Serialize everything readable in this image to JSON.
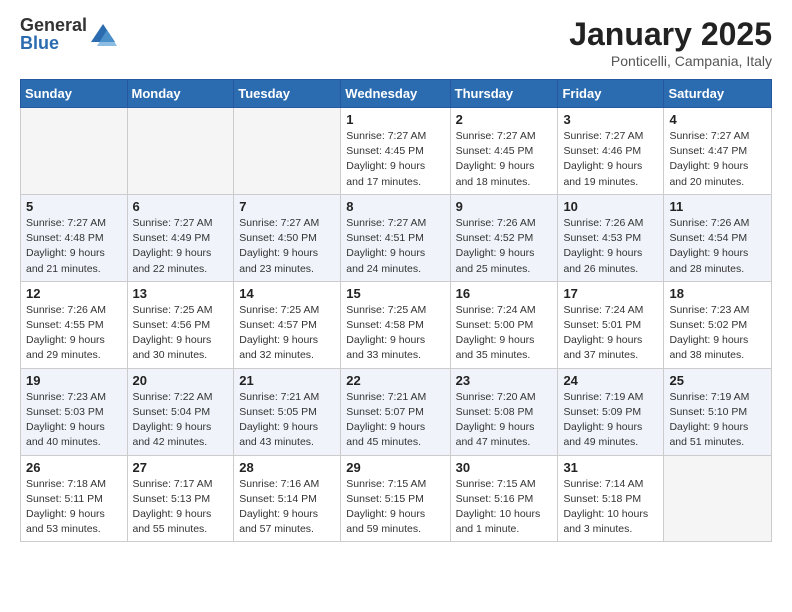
{
  "logo": {
    "general": "General",
    "blue": "Blue"
  },
  "title": {
    "month": "January 2025",
    "location": "Ponticelli, Campania, Italy"
  },
  "weekdays": [
    "Sunday",
    "Monday",
    "Tuesday",
    "Wednesday",
    "Thursday",
    "Friday",
    "Saturday"
  ],
  "weeks": [
    [
      {
        "day": "",
        "info": ""
      },
      {
        "day": "",
        "info": ""
      },
      {
        "day": "",
        "info": ""
      },
      {
        "day": "1",
        "info": "Sunrise: 7:27 AM\nSunset: 4:45 PM\nDaylight: 9 hours\nand 17 minutes."
      },
      {
        "day": "2",
        "info": "Sunrise: 7:27 AM\nSunset: 4:45 PM\nDaylight: 9 hours\nand 18 minutes."
      },
      {
        "day": "3",
        "info": "Sunrise: 7:27 AM\nSunset: 4:46 PM\nDaylight: 9 hours\nand 19 minutes."
      },
      {
        "day": "4",
        "info": "Sunrise: 7:27 AM\nSunset: 4:47 PM\nDaylight: 9 hours\nand 20 minutes."
      }
    ],
    [
      {
        "day": "5",
        "info": "Sunrise: 7:27 AM\nSunset: 4:48 PM\nDaylight: 9 hours\nand 21 minutes."
      },
      {
        "day": "6",
        "info": "Sunrise: 7:27 AM\nSunset: 4:49 PM\nDaylight: 9 hours\nand 22 minutes."
      },
      {
        "day": "7",
        "info": "Sunrise: 7:27 AM\nSunset: 4:50 PM\nDaylight: 9 hours\nand 23 minutes."
      },
      {
        "day": "8",
        "info": "Sunrise: 7:27 AM\nSunset: 4:51 PM\nDaylight: 9 hours\nand 24 minutes."
      },
      {
        "day": "9",
        "info": "Sunrise: 7:26 AM\nSunset: 4:52 PM\nDaylight: 9 hours\nand 25 minutes."
      },
      {
        "day": "10",
        "info": "Sunrise: 7:26 AM\nSunset: 4:53 PM\nDaylight: 9 hours\nand 26 minutes."
      },
      {
        "day": "11",
        "info": "Sunrise: 7:26 AM\nSunset: 4:54 PM\nDaylight: 9 hours\nand 28 minutes."
      }
    ],
    [
      {
        "day": "12",
        "info": "Sunrise: 7:26 AM\nSunset: 4:55 PM\nDaylight: 9 hours\nand 29 minutes."
      },
      {
        "day": "13",
        "info": "Sunrise: 7:25 AM\nSunset: 4:56 PM\nDaylight: 9 hours\nand 30 minutes."
      },
      {
        "day": "14",
        "info": "Sunrise: 7:25 AM\nSunset: 4:57 PM\nDaylight: 9 hours\nand 32 minutes."
      },
      {
        "day": "15",
        "info": "Sunrise: 7:25 AM\nSunset: 4:58 PM\nDaylight: 9 hours\nand 33 minutes."
      },
      {
        "day": "16",
        "info": "Sunrise: 7:24 AM\nSunset: 5:00 PM\nDaylight: 9 hours\nand 35 minutes."
      },
      {
        "day": "17",
        "info": "Sunrise: 7:24 AM\nSunset: 5:01 PM\nDaylight: 9 hours\nand 37 minutes."
      },
      {
        "day": "18",
        "info": "Sunrise: 7:23 AM\nSunset: 5:02 PM\nDaylight: 9 hours\nand 38 minutes."
      }
    ],
    [
      {
        "day": "19",
        "info": "Sunrise: 7:23 AM\nSunset: 5:03 PM\nDaylight: 9 hours\nand 40 minutes."
      },
      {
        "day": "20",
        "info": "Sunrise: 7:22 AM\nSunset: 5:04 PM\nDaylight: 9 hours\nand 42 minutes."
      },
      {
        "day": "21",
        "info": "Sunrise: 7:21 AM\nSunset: 5:05 PM\nDaylight: 9 hours\nand 43 minutes."
      },
      {
        "day": "22",
        "info": "Sunrise: 7:21 AM\nSunset: 5:07 PM\nDaylight: 9 hours\nand 45 minutes."
      },
      {
        "day": "23",
        "info": "Sunrise: 7:20 AM\nSunset: 5:08 PM\nDaylight: 9 hours\nand 47 minutes."
      },
      {
        "day": "24",
        "info": "Sunrise: 7:19 AM\nSunset: 5:09 PM\nDaylight: 9 hours\nand 49 minutes."
      },
      {
        "day": "25",
        "info": "Sunrise: 7:19 AM\nSunset: 5:10 PM\nDaylight: 9 hours\nand 51 minutes."
      }
    ],
    [
      {
        "day": "26",
        "info": "Sunrise: 7:18 AM\nSunset: 5:11 PM\nDaylight: 9 hours\nand 53 minutes."
      },
      {
        "day": "27",
        "info": "Sunrise: 7:17 AM\nSunset: 5:13 PM\nDaylight: 9 hours\nand 55 minutes."
      },
      {
        "day": "28",
        "info": "Sunrise: 7:16 AM\nSunset: 5:14 PM\nDaylight: 9 hours\nand 57 minutes."
      },
      {
        "day": "29",
        "info": "Sunrise: 7:15 AM\nSunset: 5:15 PM\nDaylight: 9 hours\nand 59 minutes."
      },
      {
        "day": "30",
        "info": "Sunrise: 7:15 AM\nSunset: 5:16 PM\nDaylight: 10 hours\nand 1 minute."
      },
      {
        "day": "31",
        "info": "Sunrise: 7:14 AM\nSunset: 5:18 PM\nDaylight: 10 hours\nand 3 minutes."
      },
      {
        "day": "",
        "info": ""
      }
    ]
  ]
}
